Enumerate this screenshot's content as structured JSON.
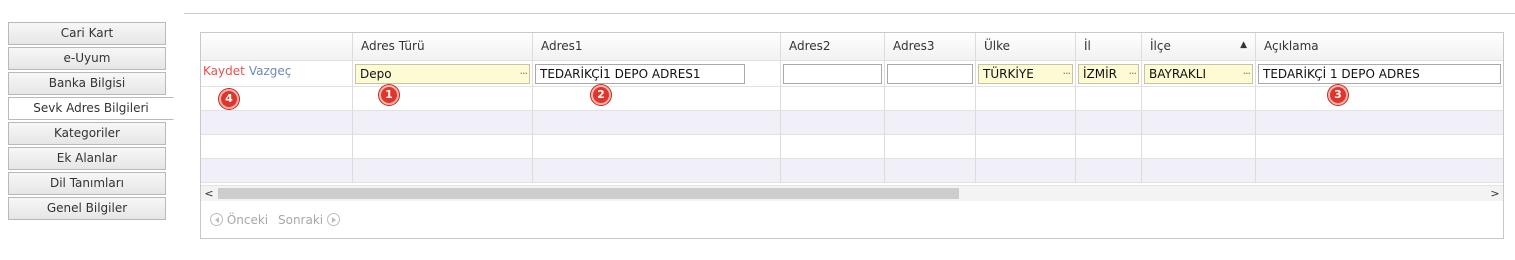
{
  "tabs": [
    {
      "label": "Cari Kart",
      "active": false
    },
    {
      "label": "e-Uyum",
      "active": false
    },
    {
      "label": "Banka Bilgisi",
      "active": false
    },
    {
      "label": "Sevk Adres Bilgileri",
      "active": true
    },
    {
      "label": "Kategoriler",
      "active": false
    },
    {
      "label": "Ek Alanlar",
      "active": false
    },
    {
      "label": "Dil Tanımları",
      "active": false
    },
    {
      "label": "Genel Bilgiler",
      "active": false
    }
  ],
  "grid": {
    "columns": [
      "",
      "Adres Türü",
      "Adres1",
      "Adres2",
      "Adres3",
      "Ülke",
      "İl",
      "İlçe",
      "Açıklama"
    ],
    "sorted_column": "İlçe",
    "sort_direction": "ascending",
    "edit_row": {
      "save_label": "Kaydet",
      "cancel_label": "Vazgeç",
      "adres_turu": "Depo",
      "adres1": "TEDARİKÇİ1 DEPO ADRES1",
      "adres2": "",
      "adres3": "",
      "ulke": "TÜRKİYE",
      "il": "İZMİR",
      "ilce": "BAYRAKLI",
      "aciklama": "TEDARİKÇİ 1 DEPO ADRES"
    },
    "empty_rows": 4
  },
  "badges": [
    "1",
    "2",
    "3",
    "4"
  ],
  "pager": {
    "prev_label": "Önceki",
    "next_label": "Sonraki"
  },
  "scrollbar": {
    "left_arrow": "<",
    "right_arrow": ">"
  },
  "lookup_button_glyph": "···",
  "sort_glyph": "▲",
  "colors": {
    "badge": "#e0352b",
    "save": "#e4524d",
    "cancel": "#6f88b8",
    "field_highlight": "#fdfbd3",
    "alt_row": "#f1eff7"
  }
}
